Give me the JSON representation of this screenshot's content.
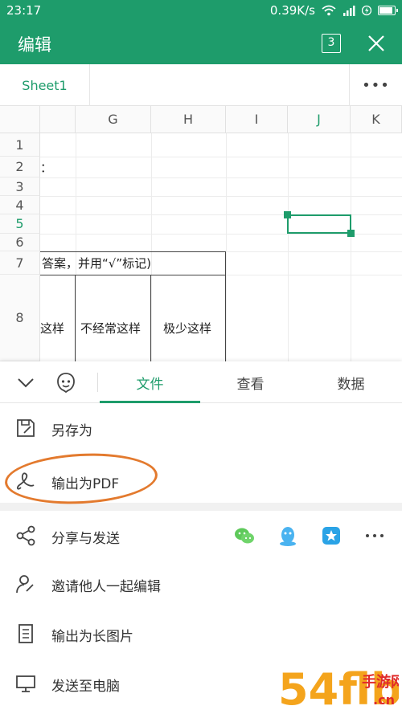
{
  "status_bar": {
    "time": "23:17",
    "speed": "0.39K/s"
  },
  "app_bar": {
    "title": "编辑",
    "tab_count": "3"
  },
  "sheet_bar": {
    "sheet_name": "Sheet1",
    "more": "•••"
  },
  "grid": {
    "columns": [
      "G",
      "H",
      "I",
      "J",
      "K"
    ],
    "rows": [
      "1",
      "2",
      "3",
      "4",
      "5",
      "6",
      "7",
      "8"
    ],
    "cells": {
      "r2": "：",
      "r7": "答案，并用“√”标记)",
      "r8_c1": "这样",
      "r8_c2": "不经常这样",
      "r8_c3": "极少这样"
    }
  },
  "panel": {
    "tabs": [
      "文件",
      "查看",
      "数据"
    ],
    "active_tab": "文件",
    "items": {
      "save_as": "另存为",
      "export_pdf": "输出为PDF",
      "share_send": "分享与发送",
      "invite_edit": "邀请他人一起编辑",
      "export_image": "输出为长图片",
      "send_pc": "发送至电脑"
    },
    "share_icons": [
      "wechat-icon",
      "qq-icon",
      "qzone-icon",
      "more-icon"
    ]
  },
  "watermark": {
    "text": "54flb手游网",
    "sub": ".cn"
  },
  "colors": {
    "accent": "#1e9c6b",
    "annotation": "#e37a2e"
  }
}
